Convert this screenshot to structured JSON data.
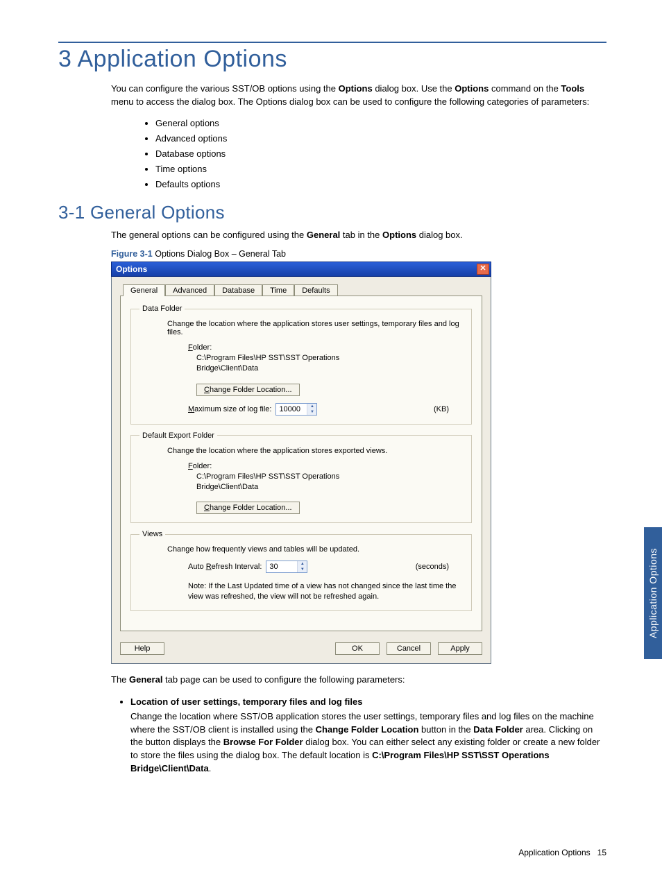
{
  "headings": {
    "h1": "3 Application Options",
    "h2": "3-1 General Options"
  },
  "intro": {
    "p1a": "You can configure the various SST/OB options using the ",
    "p1b": "Options",
    "p1c": " dialog box.  Use the ",
    "p1d": "Options",
    "p1e": " command on the ",
    "p1f": "Tools",
    "p1g": " menu to access the dialog box.  The Options dialog box can be used to configure the following categories of parameters:",
    "cats": [
      "General options",
      "Advanced options",
      "Database options",
      "Time options",
      "Defaults options"
    ],
    "p2a": "The general options can be configured using the ",
    "p2b": "General",
    "p2c": " tab in the ",
    "p2d": "Options",
    "p2e": " dialog box."
  },
  "figure": {
    "label": "Figure 3-1",
    "caption": " Options Dialog Box – General Tab"
  },
  "dialog": {
    "title": "Options",
    "tabs": [
      "General",
      "Advanced",
      "Database",
      "Time",
      "Defaults"
    ],
    "dataFolder": {
      "legend": "Data Folder",
      "desc": "Change the location where the application stores user settings, temporary files and log files.",
      "folderLabel": "Folder:",
      "path1": "C:\\Program Files\\HP SST\\SST Operations",
      "path2": "Bridge\\Client\\Data",
      "changeBtn": "Change Folder Location...",
      "maxLabel": "Maximum size of log file:",
      "maxValue": "10000",
      "maxUnit": "(KB)"
    },
    "exportFolder": {
      "legend": "Default Export Folder",
      "desc": "Change the location where the application stores exported views.",
      "folderLabel": "Folder:",
      "path1": "C:\\Program Files\\HP SST\\SST Operations",
      "path2": "Bridge\\Client\\Data",
      "changeBtn": "Change Folder Location..."
    },
    "views": {
      "legend": "Views",
      "desc": "Change how frequently views and tables will be updated.",
      "refreshLabel": "Auto Refresh Interval:",
      "refreshValue": "30",
      "refreshUnit": "(seconds)",
      "note": "Note: If the Last Updated time of a view has not changed since the last time the view was refreshed, the view will not be refreshed again."
    },
    "buttons": {
      "help": "Help",
      "ok": "OK",
      "cancel": "Cancel",
      "apply": "Apply"
    }
  },
  "after": {
    "p1a": "The ",
    "p1b": "General",
    "p1c": " tab page can be used to configure the following parameters:",
    "bullet_lead": "Location of user settings, temporary files and log files",
    "bp_a": "Change the location where SST/OB application stores the user settings, temporary files and log files on the machine where the SST/OB client is installed using the ",
    "bp_b": "Change Folder Location",
    "bp_c": " button in the ",
    "bp_d": "Data Folder",
    "bp_e": " area.  Clicking on the button displays the ",
    "bp_f": "Browse For Folder",
    "bp_g": " dialog box.  You can either select any existing folder or create a new folder to store the files using the dialog box.  The default location is ",
    "bp_h": "C:\\Program Files\\HP SST\\SST Operations Bridge\\Client\\Data",
    "bp_i": "."
  },
  "sideTab": "Application Options",
  "footer": {
    "text": "Application Options",
    "page": "15"
  }
}
